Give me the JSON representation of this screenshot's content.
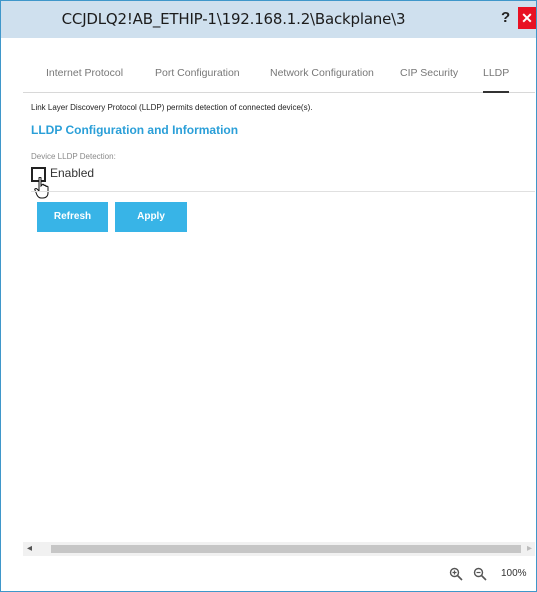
{
  "window": {
    "title": "CCJDLQ2!AB_ETHIP-1\\192.168.1.2\\Backplane\\3",
    "help_label": "?",
    "close_label": "✕"
  },
  "tabs": [
    {
      "label": "Internet Protocol"
    },
    {
      "label": "Port Configuration"
    },
    {
      "label": "Network Configuration"
    },
    {
      "label": "CIP Security"
    },
    {
      "label": "LLDP",
      "active": true
    }
  ],
  "content": {
    "description": "Link Layer Discovery Protocol (LLDP) permits detection of connected device(s).",
    "section_title": "LLDP Configuration and Information",
    "field_label": "Device LLDP Detection:",
    "checkbox": {
      "label": "Enabled",
      "checked": false
    }
  },
  "buttons": {
    "refresh": "Refresh",
    "apply": "Apply"
  },
  "status": {
    "zoom_level": "100%"
  },
  "colors": {
    "accent": "#2a9fd8",
    "button": "#38b4e7",
    "close": "#e81123",
    "titlebar": "#cfe0ee"
  }
}
